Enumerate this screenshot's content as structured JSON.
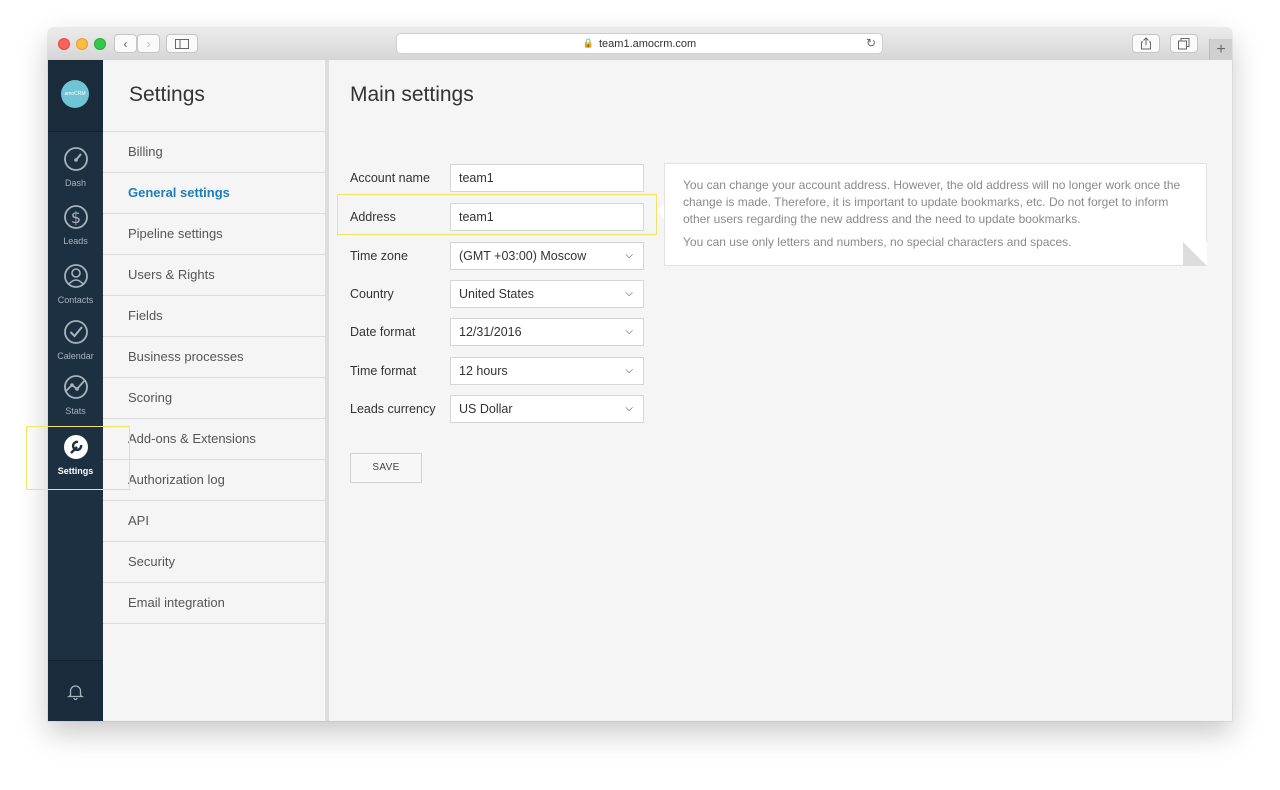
{
  "browser": {
    "url": "team1.amocrm.com"
  },
  "rail": {
    "logo_text": "amoCRM",
    "items": [
      {
        "label": "Dash",
        "icon": "dashboard-icon"
      },
      {
        "label": "Leads",
        "icon": "dollar-icon"
      },
      {
        "label": "Contacts",
        "icon": "contacts-icon"
      },
      {
        "label": "Calendar",
        "icon": "calendar-check-icon"
      },
      {
        "label": "Stats",
        "icon": "stats-icon"
      },
      {
        "label": "Settings",
        "icon": "wrench-icon"
      }
    ],
    "bell_icon": "bell-icon"
  },
  "menu": {
    "title": "Settings",
    "items": [
      "Billing",
      "General settings",
      "Pipeline settings",
      "Users & Rights",
      "Fields",
      "Business processes",
      "Scoring",
      "Add-ons & Extensions",
      "Authorization log",
      "API",
      "Security",
      "Email integration"
    ],
    "active": "General settings"
  },
  "main": {
    "title": "Main settings",
    "fields": {
      "account_name": {
        "label": "Account name",
        "value": "team1"
      },
      "address": {
        "label": "Address",
        "value": "team1"
      },
      "time_zone": {
        "label": "Time zone",
        "value": "(GMT +03:00) Moscow"
      },
      "country": {
        "label": "Country",
        "value": "United States"
      },
      "date_format": {
        "label": "Date format",
        "value": "12/31/2016"
      },
      "time_format": {
        "label": "Time format",
        "value": "12 hours"
      },
      "leads_currency": {
        "label": "Leads currency",
        "value": "US Dollar"
      }
    },
    "save_label": "SAVE",
    "hint": {
      "p1": "You can change your account address. However, the old address will no longer work once the change is made. Therefore, it is important to update bookmarks, etc. Do not forget to inform other users regarding the new address and the need to update bookmarks.",
      "p2": "You can use only letters and numbers, no special characters and spaces."
    }
  },
  "colors": {
    "rail_bg": "#1d3042",
    "accent": "#1f7db8",
    "highlight": "#f3e265"
  }
}
